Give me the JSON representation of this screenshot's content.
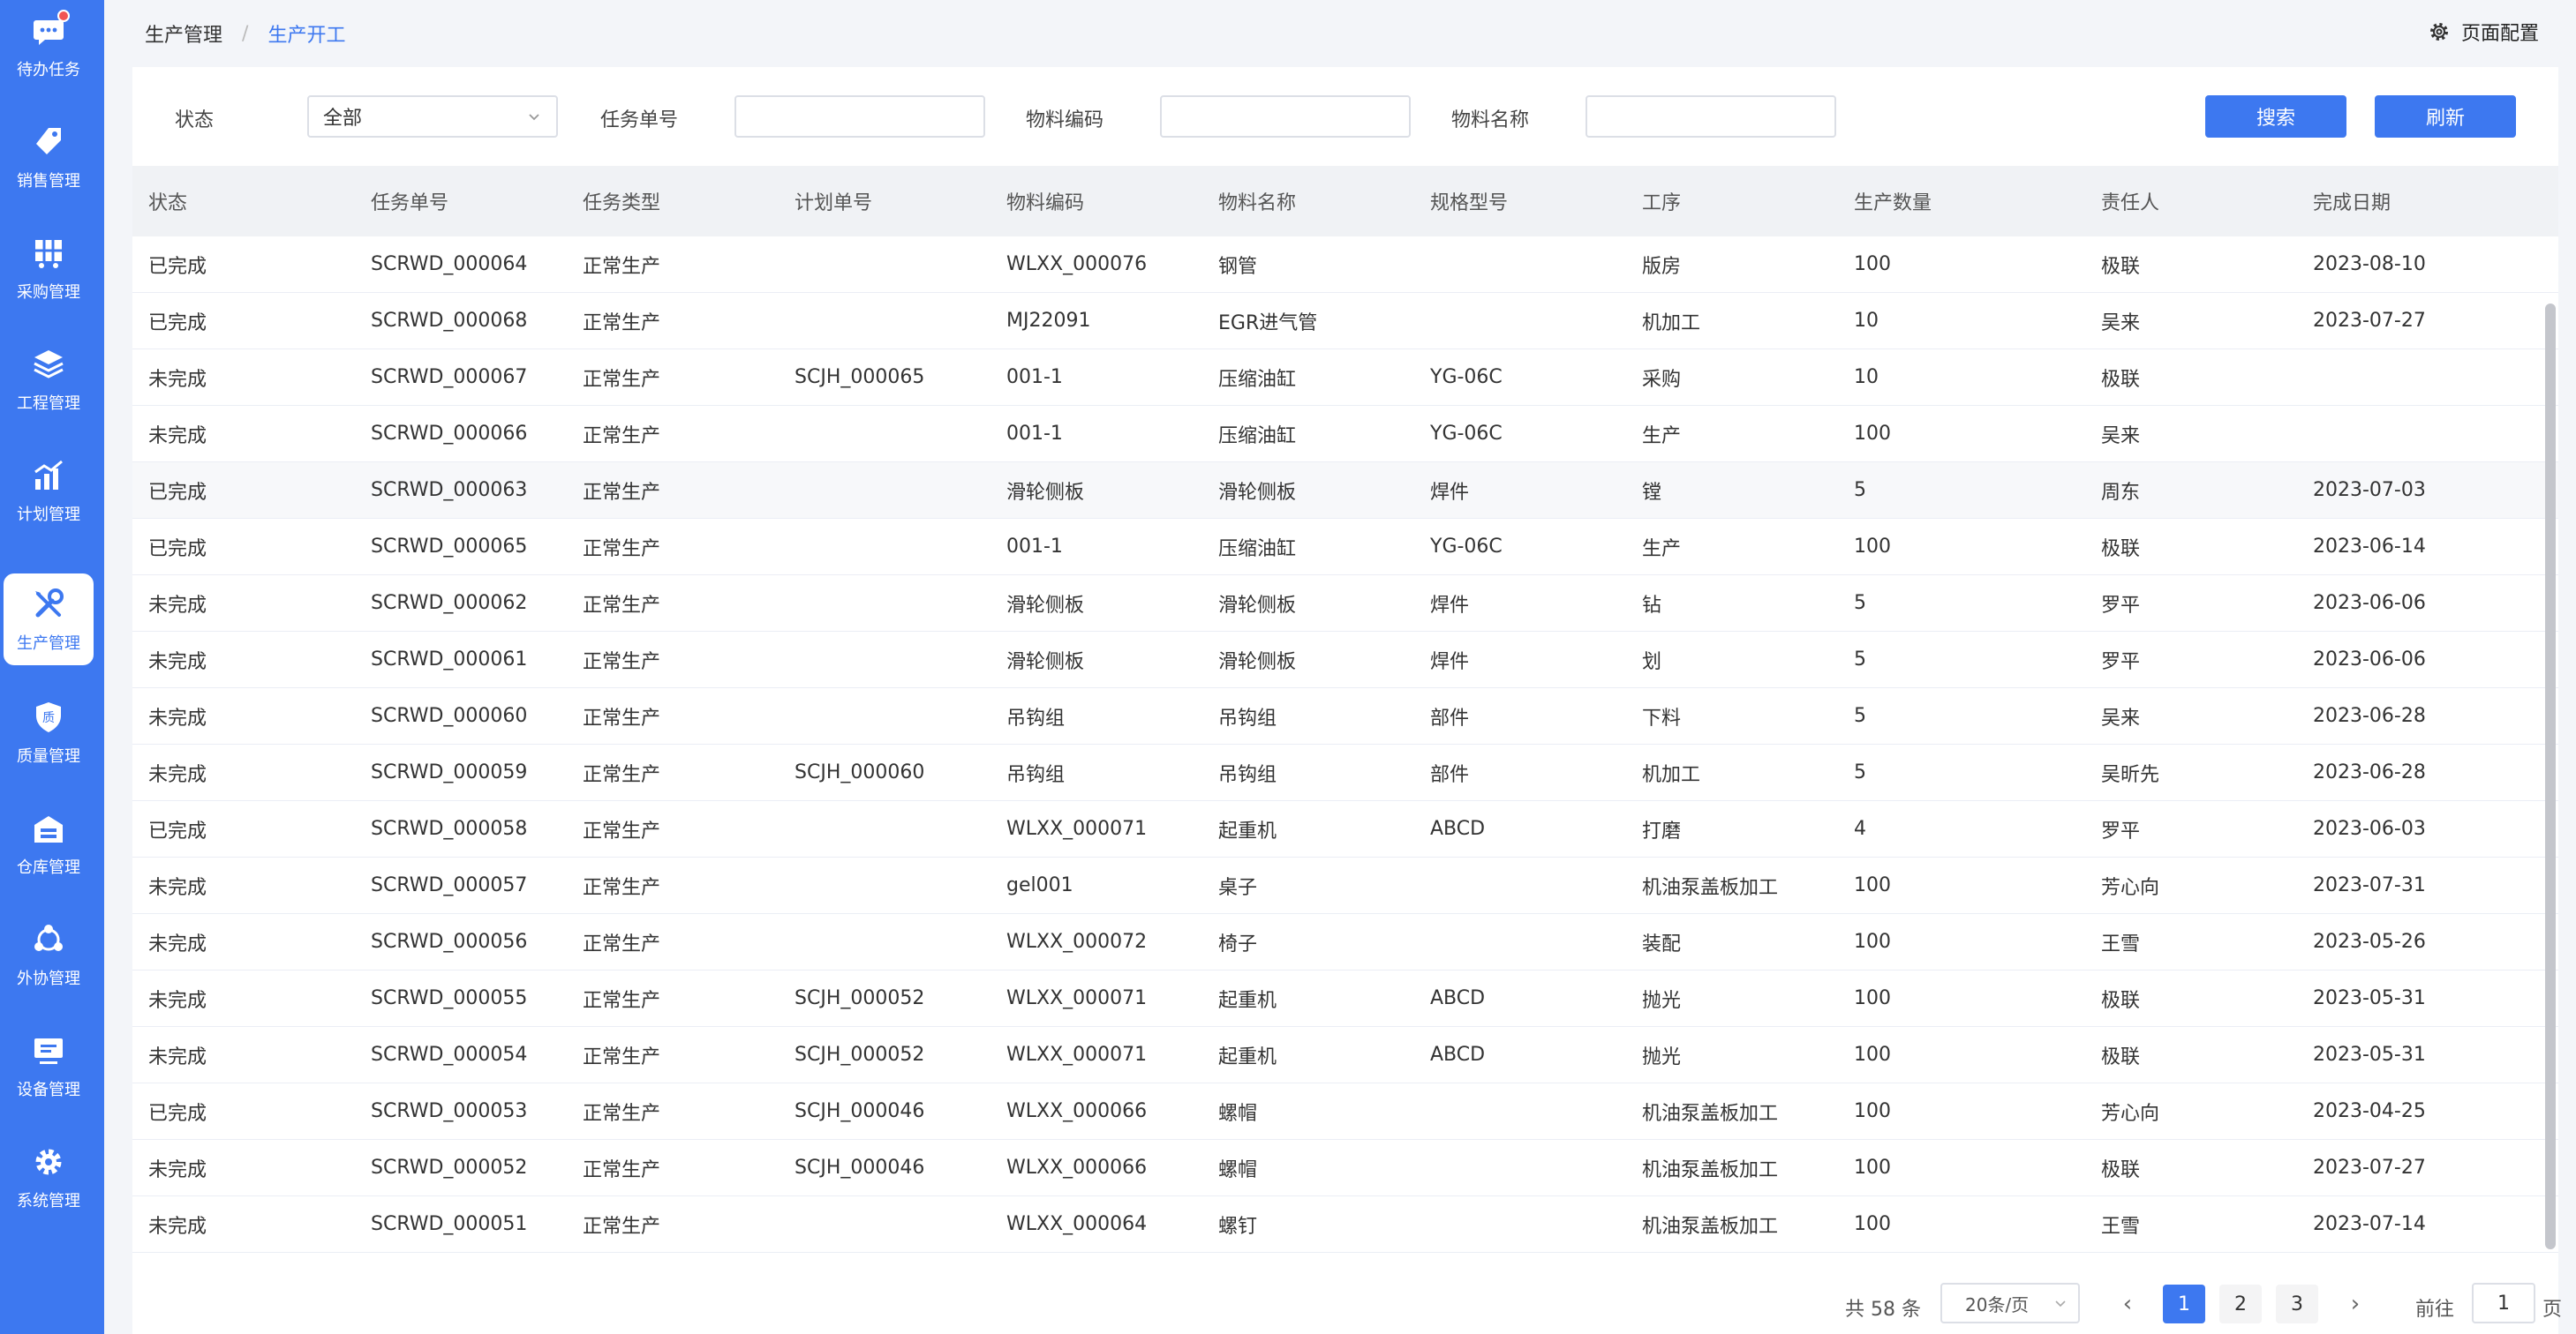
{
  "sidebar": {
    "items": [
      {
        "label": "待办任务",
        "icon": "chat-icon",
        "active": false,
        "badge": true
      },
      {
        "label": "销售管理",
        "icon": "tag-icon",
        "active": false
      },
      {
        "label": "采购管理",
        "icon": "cart-icon",
        "active": false
      },
      {
        "label": "工程管理",
        "icon": "layers-icon",
        "active": false
      },
      {
        "label": "计划管理",
        "icon": "chart-icon",
        "active": false
      },
      {
        "label": "生产管理",
        "icon": "tools-icon",
        "active": true
      },
      {
        "label": "质量管理",
        "icon": "shield-icon",
        "active": false
      },
      {
        "label": "仓库管理",
        "icon": "warehouse-icon",
        "active": false
      },
      {
        "label": "外协管理",
        "icon": "network-icon",
        "active": false
      },
      {
        "label": "设备管理",
        "icon": "monitor-icon",
        "active": false
      },
      {
        "label": "系统管理",
        "icon": "gear-icon",
        "active": false
      }
    ]
  },
  "header": {
    "breadcrumb": [
      "生产管理",
      "生产开工"
    ],
    "separator": "/",
    "page_config_label": "页面配置"
  },
  "filters": {
    "status_label": "状态",
    "status_value": "全部",
    "task_no_label": "任务单号",
    "task_no_value": "",
    "material_code_label": "物料编码",
    "material_code_value": "",
    "material_name_label": "物料名称",
    "material_name_value": "",
    "search_label": "搜索",
    "refresh_label": "刷新"
  },
  "table": {
    "columns": [
      "状态",
      "任务单号",
      "任务类型",
      "计划单号",
      "物料编码",
      "物料名称",
      "规格型号",
      "工序",
      "生产数量",
      "责任人",
      "完成日期"
    ],
    "rows": [
      [
        "已完成",
        "SCRWD_000064",
        "正常生产",
        "",
        "WLXX_000076",
        "钢管",
        "",
        "版房",
        "100",
        "极联",
        "2023-08-10"
      ],
      [
        "已完成",
        "SCRWD_000068",
        "正常生产",
        "",
        "MJ22091",
        "EGR进气管",
        "",
        "机加工",
        "10",
        "吴来",
        "2023-07-27"
      ],
      [
        "未完成",
        "SCRWD_000067",
        "正常生产",
        "SCJH_000065",
        "001-1",
        "压缩油缸",
        "YG-06C",
        "采购",
        "10",
        "极联",
        ""
      ],
      [
        "未完成",
        "SCRWD_000066",
        "正常生产",
        "",
        "001-1",
        "压缩油缸",
        "YG-06C",
        "生产",
        "100",
        "吴来",
        ""
      ],
      [
        "已完成",
        "SCRWD_000063",
        "正常生产",
        "",
        "滑轮侧板",
        "滑轮侧板",
        "焊件",
        "镗",
        "5",
        "周东",
        "2023-07-03"
      ],
      [
        "已完成",
        "SCRWD_000065",
        "正常生产",
        "",
        "001-1",
        "压缩油缸",
        "YG-06C",
        "生产",
        "100",
        "极联",
        "2023-06-14"
      ],
      [
        "未完成",
        "SCRWD_000062",
        "正常生产",
        "",
        "滑轮侧板",
        "滑轮侧板",
        "焊件",
        "钻",
        "5",
        "罗平",
        "2023-06-06"
      ],
      [
        "未完成",
        "SCRWD_000061",
        "正常生产",
        "",
        "滑轮侧板",
        "滑轮侧板",
        "焊件",
        "划",
        "5",
        "罗平",
        "2023-06-06"
      ],
      [
        "未完成",
        "SCRWD_000060",
        "正常生产",
        "",
        "吊钩组",
        "吊钩组",
        "部件",
        "下料",
        "5",
        "吴来",
        "2023-06-28"
      ],
      [
        "未完成",
        "SCRWD_000059",
        "正常生产",
        "SCJH_000060",
        "吊钩组",
        "吊钩组",
        "部件",
        "机加工",
        "5",
        "吴昕先",
        "2023-06-28"
      ],
      [
        "已完成",
        "SCRWD_000058",
        "正常生产",
        "",
        "WLXX_000071",
        "起重机",
        "ABCD",
        "打磨",
        "4",
        "罗平",
        "2023-06-03"
      ],
      [
        "未完成",
        "SCRWD_000057",
        "正常生产",
        "",
        "gel001",
        "桌子",
        "",
        "机油泵盖板加工",
        "100",
        "芳心向",
        "2023-07-31"
      ],
      [
        "未完成",
        "SCRWD_000056",
        "正常生产",
        "",
        "WLXX_000072",
        "椅子",
        "",
        "装配",
        "100",
        "王雪",
        "2023-05-26"
      ],
      [
        "未完成",
        "SCRWD_000055",
        "正常生产",
        "SCJH_000052",
        "WLXX_000071",
        "起重机",
        "ABCD",
        "抛光",
        "100",
        "极联",
        "2023-05-31"
      ],
      [
        "未完成",
        "SCRWD_000054",
        "正常生产",
        "SCJH_000052",
        "WLXX_000071",
        "起重机",
        "ABCD",
        "抛光",
        "100",
        "极联",
        "2023-05-31"
      ],
      [
        "已完成",
        "SCRWD_000053",
        "正常生产",
        "SCJH_000046",
        "WLXX_000066",
        "螺帽",
        "",
        "机油泵盖板加工",
        "100",
        "芳心向",
        "2023-04-25"
      ],
      [
        "未完成",
        "SCRWD_000052",
        "正常生产",
        "SCJH_000046",
        "WLXX_000066",
        "螺帽",
        "",
        "机油泵盖板加工",
        "100",
        "极联",
        "2023-07-27"
      ],
      [
        "未完成",
        "SCRWD_000051",
        "正常生产",
        "",
        "WLXX_000064",
        "螺钉",
        "",
        "机油泵盖板加工",
        "100",
        "王雪",
        "2023-07-14"
      ]
    ]
  },
  "pagination": {
    "total_label": "共 58 条",
    "page_size_label": "20条/页",
    "pages": [
      "1",
      "2",
      "3"
    ],
    "current_page": "1",
    "prev_symbol": "‹",
    "next_symbol": "›",
    "goto_prefix": "前往",
    "goto_value": "1",
    "goto_suffix": "页"
  },
  "colors": {
    "primary": "#3d78f0",
    "badge": "#f15555"
  }
}
